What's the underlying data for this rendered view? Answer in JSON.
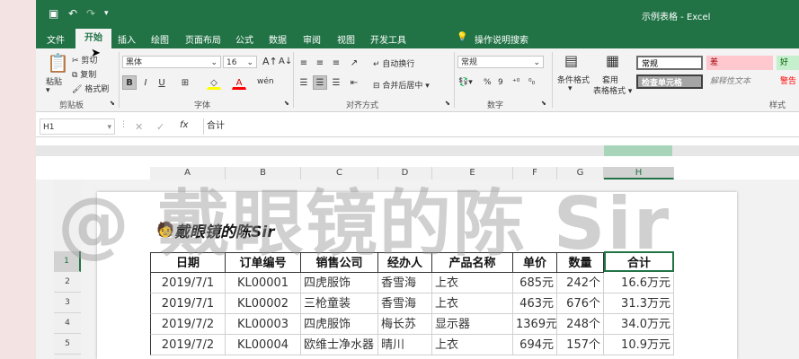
{
  "window": {
    "title": "示例表格 - Excel"
  },
  "tabs": [
    "文件",
    "开始",
    "插入",
    "绘图",
    "页面布局",
    "公式",
    "数据",
    "审阅",
    "视图",
    "开发工具"
  ],
  "tell_me": "操作说明搜索",
  "ribbon": {
    "paste": "粘贴",
    "cut": "剪切",
    "copy": "复制",
    "format_painter": "格式刷",
    "clipboard_group": "剪贴板",
    "font_name": "黑体",
    "font_size": "16",
    "font_group": "字体",
    "wrap_text": "自动换行",
    "merge_center": "合并后居中",
    "align_group": "对齐方式",
    "number_format": "常规",
    "number_group": "数字",
    "conditional_format": "条件格式",
    "format_table": "套用\n表格格式",
    "styles": {
      "normal": "常规",
      "bad": "差",
      "good": "好",
      "check_cell": "检查单元格",
      "explanatory": "解释性文本",
      "warning": "警告"
    },
    "styles_group": "样式"
  },
  "formula_bar": {
    "name_box": "H1",
    "fx": "fx",
    "value": "合计"
  },
  "columns": [
    "A",
    "B",
    "C",
    "D",
    "E",
    "F",
    "G",
    "H"
  ],
  "rows": [
    "1",
    "2",
    "3",
    "4",
    "5"
  ],
  "table": {
    "headers": [
      "日期",
      "订单编号",
      "销售公司",
      "经办人",
      "产品名称",
      "单价",
      "数量",
      "合计"
    ],
    "data": [
      [
        "2019/7/1",
        "KL00001",
        "四虎服饰",
        "香雪海",
        "上衣",
        "685元",
        "242个",
        "16.6万元"
      ],
      [
        "2019/7/1",
        "KL00002",
        "三枪童装",
        "香雪海",
        "上衣",
        "463元",
        "676个",
        "31.3万元"
      ],
      [
        "2019/7/2",
        "KL00003",
        "四虎服饰",
        "梅长苏",
        "显示器",
        "1369元",
        "248个",
        "34.0万元"
      ],
      [
        "2019/7/2",
        "KL00004",
        "欧维士净水器",
        "晴川",
        "上衣",
        "694元",
        "157个",
        "10.9万元"
      ]
    ]
  },
  "watermark": "@ 戴眼镜的陈 Sir",
  "logo_text": "戴眼镜的陈Sir",
  "colors": {
    "brand": "#217346"
  }
}
